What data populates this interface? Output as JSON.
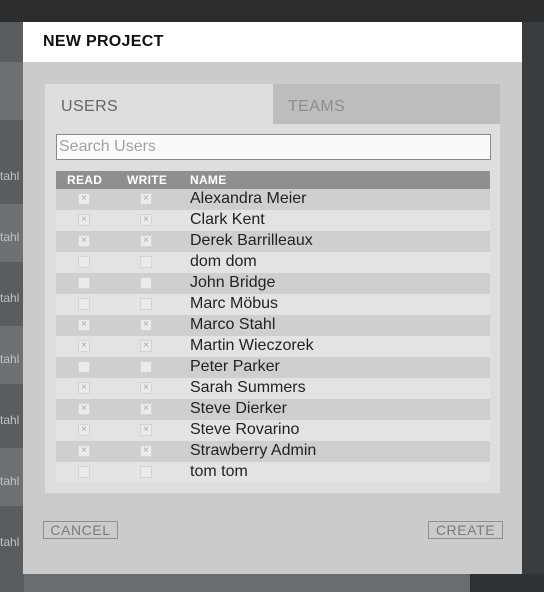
{
  "background": {
    "row_fragments": [
      "tahl",
      "tahl",
      "tahl",
      "tahl",
      "tahl",
      "tahl",
      "tahl"
    ]
  },
  "dialog": {
    "title": "NEW PROJECT",
    "tabs": [
      {
        "label": "USERS",
        "active": true
      },
      {
        "label": "TEAMS",
        "active": false
      }
    ],
    "search": {
      "placeholder": "Search Users",
      "value": ""
    },
    "columns": {
      "read": "READ",
      "write": "WRITE",
      "name": "NAME"
    },
    "users": [
      {
        "name": "Alexandra Meier",
        "read": true,
        "write": true
      },
      {
        "name": "Clark Kent",
        "read": true,
        "write": true
      },
      {
        "name": "Derek Barrilleaux",
        "read": true,
        "write": true
      },
      {
        "name": "dom dom",
        "read": false,
        "write": false
      },
      {
        "name": "John Bridge",
        "read": false,
        "write": false
      },
      {
        "name": "Marc Möbus",
        "read": false,
        "write": false
      },
      {
        "name": "Marco Stahl",
        "read": true,
        "write": true
      },
      {
        "name": "Martin Wieczorek",
        "read": true,
        "write": true
      },
      {
        "name": "Peter Parker",
        "read": false,
        "write": false
      },
      {
        "name": "Sarah Summers",
        "read": true,
        "write": true
      },
      {
        "name": "Steve Dierker",
        "read": true,
        "write": true
      },
      {
        "name": "Steve Rovarino",
        "read": true,
        "write": true
      },
      {
        "name": "Strawberry Admin",
        "read": true,
        "write": true
      },
      {
        "name": "tom tom",
        "read": false,
        "write": false
      }
    ],
    "cancel_label": "CANCEL",
    "create_label": "CREATE"
  },
  "colors": {
    "overlay": "#3c3f42",
    "dialog": "#cbcbcb",
    "panel": "#dedede",
    "header_row": "#8f8f8f"
  }
}
